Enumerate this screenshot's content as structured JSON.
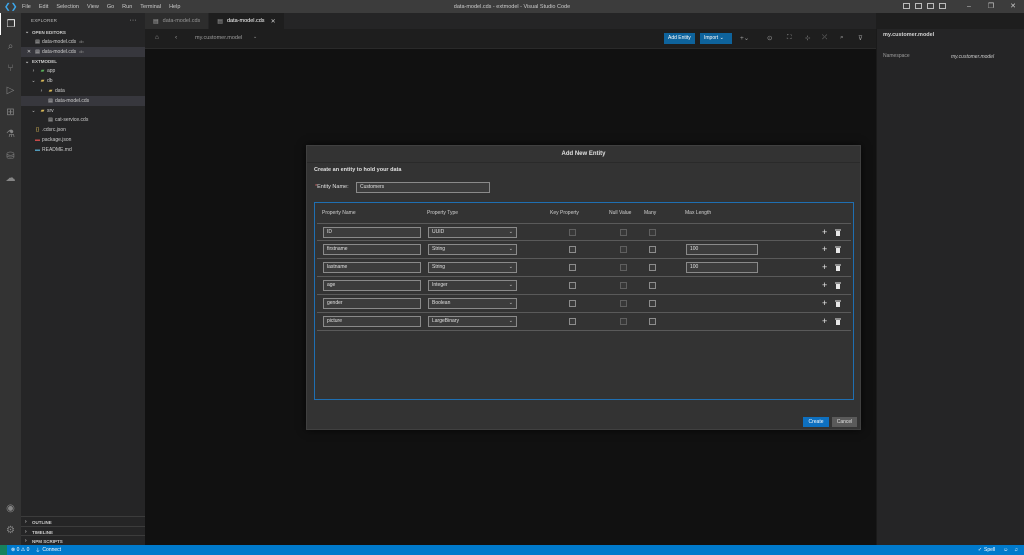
{
  "window": {
    "title": "data-model.cds - extmodel - Visual Studio Code",
    "menu": [
      "File",
      "Edit",
      "Selection",
      "View",
      "Go",
      "Run",
      "Terminal",
      "Help"
    ]
  },
  "sidebar": {
    "title": "EXPLORER",
    "open_editors_label": "OPEN EDITORS",
    "open_editors": [
      {
        "name": "data-model.cds",
        "desc": "db"
      },
      {
        "name": "data-model.cds",
        "desc": "db"
      }
    ],
    "project_label": "EXTMODEL",
    "tree": [
      {
        "name": "app",
        "icon": "folder",
        "indent": 1
      },
      {
        "name": "db",
        "icon": "folder-open",
        "indent": 1
      },
      {
        "name": "data",
        "icon": "folder",
        "indent": 2
      },
      {
        "name": "data-model.cds",
        "icon": "file",
        "indent": 2
      },
      {
        "name": "srv",
        "icon": "folder-open",
        "indent": 1
      },
      {
        "name": "cat-service.cds",
        "icon": "file",
        "indent": 2
      },
      {
        "name": ".cdsrc.json",
        "icon": "json",
        "indent": 1
      },
      {
        "name": "package.json",
        "icon": "json",
        "indent": 1
      },
      {
        "name": "README.md",
        "icon": "md",
        "indent": 1
      }
    ],
    "bottom_sections": [
      "OUTLINE",
      "TIMELINE",
      "NPM SCRIPTS"
    ]
  },
  "tabs": [
    {
      "label": "data-model.cds",
      "active": false
    },
    {
      "label": "data-model.cds",
      "active": true
    }
  ],
  "editor_toolbar": {
    "breadcrumb": "my.customer.model",
    "add_entity_label": "Add Entity",
    "import_label": "Import"
  },
  "right_panel": {
    "title": "my.customer.model",
    "namespace_label": "Namespace",
    "namespace_value": "my.customer.model"
  },
  "dialog": {
    "title": "Add New Entity",
    "subtitle": "Create an entity to hold your data",
    "entity_name_label": "Entity Name:",
    "entity_name_value": "Customers",
    "columns": [
      "Property Name",
      "Property Type",
      "Key Property",
      "Null Value",
      "Many",
      "Max Length"
    ],
    "properties": [
      {
        "name": "ID",
        "type": "UUID",
        "max_length": ""
      },
      {
        "name": "firstname",
        "type": "String",
        "max_length": "100"
      },
      {
        "name": "lastname",
        "type": "String",
        "max_length": "100"
      },
      {
        "name": "age",
        "type": "Integer",
        "max_length": ""
      },
      {
        "name": "gender",
        "type": "Boolean",
        "max_length": ""
      },
      {
        "name": "picture",
        "type": "LargeBinary",
        "max_length": ""
      }
    ],
    "create_label": "Create",
    "cancel_label": "Cancel"
  },
  "statusbar": {
    "problems": "⊗ 0 ⚠ 0",
    "connect": "Connect",
    "spell": "Spell"
  },
  "colors": {
    "accent": "#007acc",
    "button": "#0e639c",
    "dialog_bg": "#333333",
    "table_border": "#1f6fb2"
  }
}
